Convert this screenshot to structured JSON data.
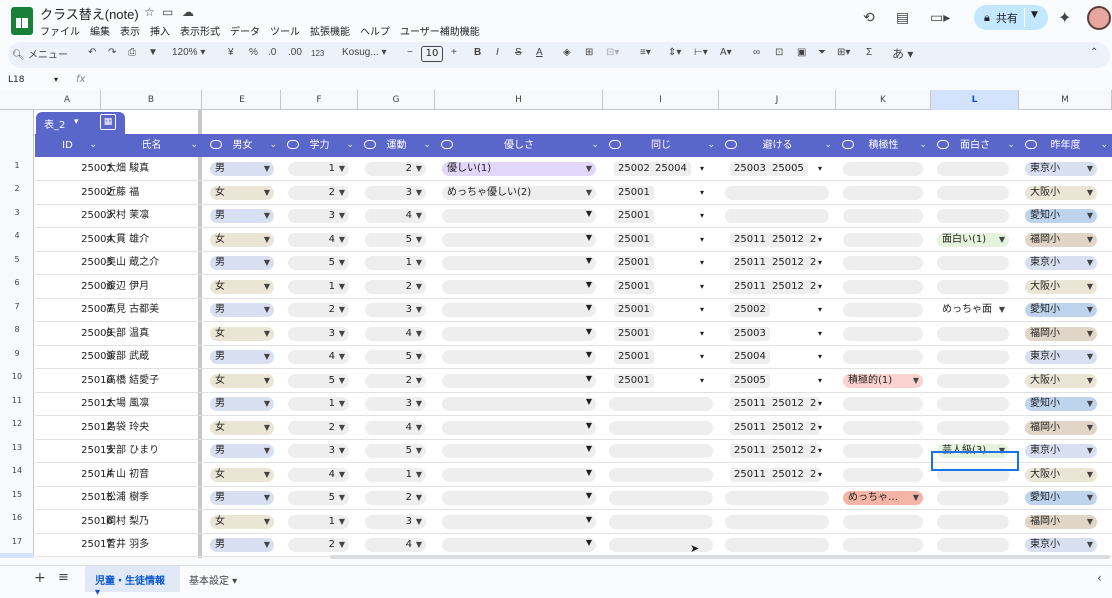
{
  "doc": {
    "title": "クラス替え(note)"
  },
  "menu": [
    "ファイル",
    "編集",
    "表示",
    "挿入",
    "表示形式",
    "データ",
    "ツール",
    "拡張機能",
    "ヘルプ",
    "ユーザー補助機能"
  ],
  "share": {
    "label": "共有"
  },
  "toolbar": {
    "search": "メニュー",
    "zoom": "120%",
    "currency": "¥",
    "percent": "%",
    "dec_dec": ".0",
    "dec_inc": ".00",
    "format123": "123",
    "font": "Kosug...",
    "font_size": "10",
    "ime": "あ"
  },
  "formula": {
    "cell_ref": "L18",
    "fx": "fx"
  },
  "columns": [
    "A",
    "B",
    "E",
    "F",
    "G",
    "H",
    "I",
    "J",
    "K",
    "L",
    "M"
  ],
  "table": {
    "name": "表_2",
    "headers": [
      "ID",
      "氏名",
      "男女",
      "学力",
      "運動",
      "優しさ",
      "同じ",
      "避ける",
      "積極性",
      "面白さ",
      "昨年度"
    ]
  },
  "rows": [
    {
      "n": "2",
      "id": "25001",
      "name": "大畑 駿真",
      "sex": "男",
      "ac": "1",
      "sp": "2",
      "kind": "優しい(1)",
      "same": [
        "25002",
        "25004"
      ],
      "avoid": [
        "25003",
        "25005"
      ],
      "act": "",
      "fun": "",
      "prev": "東京小"
    },
    {
      "n": "3",
      "id": "25002",
      "name": "近藤 福",
      "sex": "女",
      "ac": "2",
      "sp": "3",
      "kind": "めっちゃ優しい(2)",
      "same": [
        "25001"
      ],
      "avoid": [],
      "act": "",
      "fun": "",
      "prev": "大阪小"
    },
    {
      "n": "4",
      "id": "25003",
      "name": "沢村 茉凛",
      "sex": "男",
      "ac": "3",
      "sp": "4",
      "kind": "",
      "same": [
        "25001"
      ],
      "avoid": [],
      "act": "",
      "fun": "",
      "prev": "愛知小"
    },
    {
      "n": "5",
      "id": "25004",
      "name": "大貫 雄介",
      "sex": "女",
      "ac": "4",
      "sp": "5",
      "kind": "",
      "same": [
        "25001"
      ],
      "avoid": [
        "25011",
        "25012",
        "2"
      ],
      "act": "",
      "fun": "面白い(1)",
      "prev": "福岡小"
    },
    {
      "n": "6",
      "id": "25005",
      "name": "奥山 蔵之介",
      "sex": "男",
      "ac": "5",
      "sp": "1",
      "kind": "",
      "same": [
        "25001"
      ],
      "avoid": [
        "25011",
        "25012",
        "2"
      ],
      "act": "",
      "fun": "",
      "prev": "東京小"
    },
    {
      "n": "7",
      "id": "25006",
      "name": "渡辺 伊月",
      "sex": "女",
      "ac": "1",
      "sp": "2",
      "kind": "",
      "same": [
        "25001"
      ],
      "avoid": [
        "25011",
        "25012",
        "2"
      ],
      "act": "",
      "fun": "",
      "prev": "大阪小"
    },
    {
      "n": "8",
      "id": "25007",
      "name": "高見 古都美",
      "sex": "男",
      "ac": "2",
      "sp": "3",
      "kind": "",
      "same": [
        "25001"
      ],
      "avoid": [
        "25002"
      ],
      "act": "",
      "fun": "めっちゃ面",
      "prev": "愛知小"
    },
    {
      "n": "9",
      "id": "25008",
      "name": "矢部 温真",
      "sex": "女",
      "ac": "3",
      "sp": "4",
      "kind": "",
      "same": [
        "25001"
      ],
      "avoid": [
        "25003"
      ],
      "act": "",
      "fun": "",
      "prev": "福岡小"
    },
    {
      "n": "10",
      "id": "25009",
      "name": "渡部 武蔵",
      "sex": "男",
      "ac": "4",
      "sp": "5",
      "kind": "",
      "same": [
        "25001"
      ],
      "avoid": [
        "25004"
      ],
      "act": "",
      "fun": "",
      "prev": "東京小"
    },
    {
      "n": "11",
      "id": "25010",
      "name": "高橋 結愛子",
      "sex": "女",
      "ac": "5",
      "sp": "2",
      "kind": "",
      "same": [
        "25001"
      ],
      "avoid": [
        "25005"
      ],
      "act": "積極的(1)",
      "fun": "",
      "prev": "大阪小"
    },
    {
      "n": "12",
      "id": "25011",
      "name": "大場 風凛",
      "sex": "男",
      "ac": "1",
      "sp": "3",
      "kind": "",
      "same": [],
      "avoid": [
        "25011",
        "25012",
        "2"
      ],
      "act": "",
      "fun": "",
      "prev": "愛知小"
    },
    {
      "n": "13",
      "id": "25012",
      "name": "島袋 玲央",
      "sex": "女",
      "ac": "2",
      "sp": "4",
      "kind": "",
      "same": [],
      "avoid": [
        "25011",
        "25012",
        "2"
      ],
      "act": "",
      "fun": "",
      "prev": "福岡小"
    },
    {
      "n": "14",
      "id": "25013",
      "name": "安部 ひまり",
      "sex": "男",
      "ac": "3",
      "sp": "5",
      "kind": "",
      "same": [],
      "avoid": [
        "25011",
        "25012",
        "2"
      ],
      "act": "",
      "fun": "芸人級(3)",
      "prev": "東京小"
    },
    {
      "n": "15",
      "id": "25014",
      "name": "片山 初音",
      "sex": "女",
      "ac": "4",
      "sp": "1",
      "kind": "",
      "same": [],
      "avoid": [
        "25011",
        "25012",
        "2"
      ],
      "act": "",
      "fun": "",
      "prev": "大阪小"
    },
    {
      "n": "16",
      "id": "25015",
      "name": "松浦 樹季",
      "sex": "男",
      "ac": "5",
      "sp": "2",
      "kind": "",
      "same": [],
      "avoid": [],
      "act": "めっちゃ…",
      "fun": "",
      "prev": "愛知小"
    },
    {
      "n": "17",
      "id": "25016",
      "name": "岡村 梨乃",
      "sex": "女",
      "ac": "1",
      "sp": "3",
      "kind": "",
      "same": [],
      "avoid": [],
      "act": "",
      "fun": "",
      "prev": "福岡小"
    },
    {
      "n": "18",
      "id": "25017",
      "name": "菅井 羽多",
      "sex": "男",
      "ac": "2",
      "sp": "4",
      "kind": "",
      "same": [],
      "avoid": [],
      "act": "",
      "fun": "",
      "prev": "東京小"
    }
  ],
  "colors": {
    "accent": "#5b66cb",
    "male": "#d7dff0",
    "female": "#ebe5d6",
    "tokyo": "#d7dff0",
    "osaka": "#ebe5d6",
    "aichi": "#bed3ee",
    "fukuoka": "#e0d5c6",
    "kind1": "#e2d6fb",
    "fun": "#e5f3dd",
    "act1": "#fad2cf",
    "act2": "#f4b5a7"
  },
  "tabs": {
    "active": "児童・生徒情報",
    "other": "基本設定"
  },
  "icons": [
    "history-icon",
    "comment-icon",
    "video-icon",
    "lock-icon",
    "gemini-icon",
    "undo-icon",
    "redo-icon",
    "print-icon",
    "paint-format-icon",
    "bold-icon",
    "italic-icon",
    "strike-icon",
    "text-color-icon",
    "fill-color-icon",
    "borders-icon",
    "merge-icon",
    "align-icon",
    "link-icon",
    "comment-add-icon",
    "image-icon",
    "filter-icon",
    "table-view-icon",
    "sigma-icon"
  ]
}
